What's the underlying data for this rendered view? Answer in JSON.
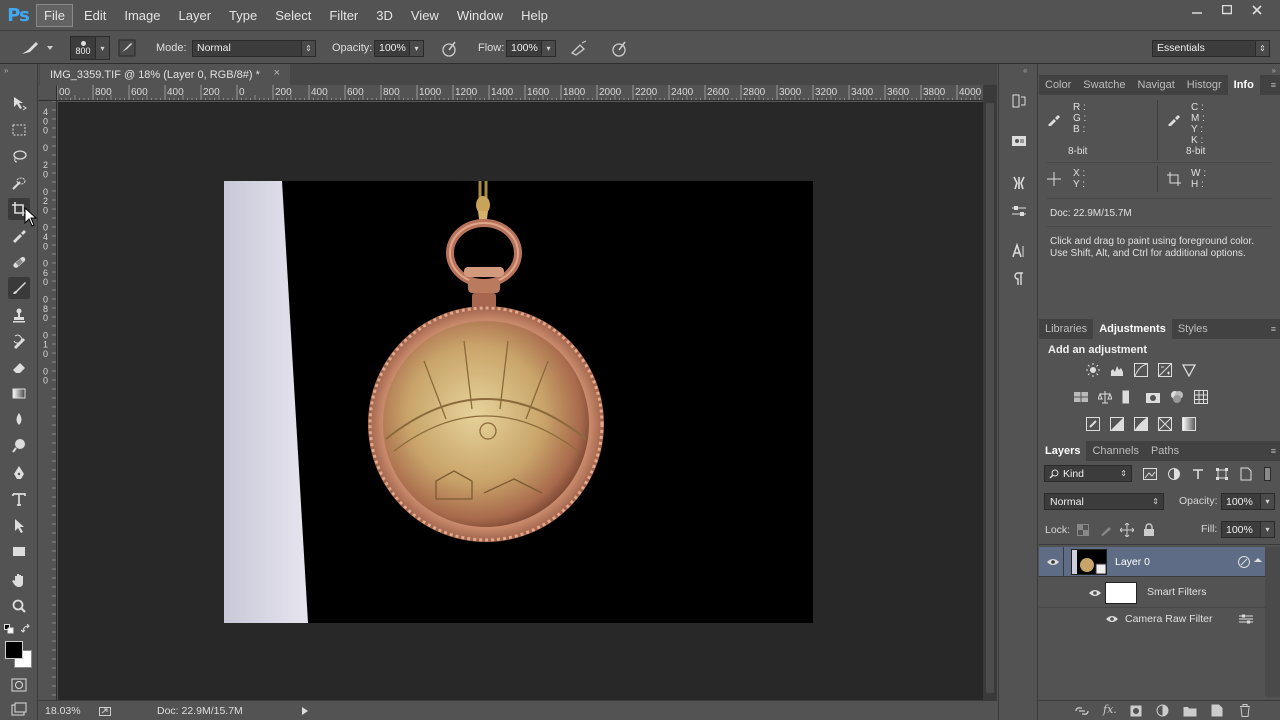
{
  "app": {
    "logo": "Ps"
  },
  "menu": [
    "File",
    "Edit",
    "Image",
    "Layer",
    "Type",
    "Select",
    "Filter",
    "3D",
    "View",
    "Window",
    "Help"
  ],
  "options_bar": {
    "brush_size": "800",
    "mode_label": "Mode:",
    "mode_value": "Normal",
    "opacity_label": "Opacity:",
    "opacity_value": "100%",
    "flow_label": "Flow:",
    "flow_value": "100%",
    "workspace": "Essentials"
  },
  "document": {
    "tab_title": "IMG_3359.TIF @ 18% (Layer 0, RGB/8#) *",
    "close_glyph": "×"
  },
  "rulers": {
    "top_ticks": [
      "00",
      "800",
      "600",
      "400",
      "200",
      "0",
      "200",
      "400",
      "600",
      "800",
      "1000",
      "1200",
      "1400",
      "1600",
      "1800",
      "2000",
      "2200",
      "2400",
      "2600",
      "2800",
      "3000",
      "3200",
      "3400",
      "3600",
      "3800",
      "4000"
    ],
    "left_ticks": [
      "4",
      "0",
      "0",
      "0",
      "2",
      "0",
      "0",
      "2",
      "0",
      "0",
      "4",
      "0",
      "0",
      "6",
      "0",
      "0",
      "8",
      "0",
      "0",
      "1",
      "0",
      "0",
      "0"
    ]
  },
  "status_bar": {
    "zoom": "18.03%",
    "doc": "Doc: 22.9M/15.7M"
  },
  "info_panel": {
    "tabs": [
      "Color",
      "Swatche",
      "Navigat",
      "Histogr",
      "Info"
    ],
    "rgb_labels": [
      "R :",
      "G :",
      "B :"
    ],
    "cmyk_labels": [
      "C :",
      "M :",
      "Y :",
      "K :"
    ],
    "bit_left": "8-bit",
    "bit_right": "8-bit",
    "xy_labels": [
      "X :",
      "Y :"
    ],
    "wh_labels": [
      "W :",
      "H :"
    ],
    "doc": "Doc: 22.9M/15.7M",
    "hint": "Click and drag to paint using foreground color. Use Shift, Alt, and Ctrl for additional options."
  },
  "adjustments_panel": {
    "tabs": [
      "Libraries",
      "Adjustments",
      "Styles"
    ],
    "title": "Add an adjustment"
  },
  "layers_panel": {
    "tabs": [
      "Layers",
      "Channels",
      "Paths"
    ],
    "filter_kind": "Kind",
    "blend_mode": "Normal",
    "opacity_label": "Opacity:",
    "opacity_value": "100%",
    "lock_label": "Lock:",
    "fill_label": "Fill:",
    "fill_value": "100%",
    "layers": [
      {
        "name": "Layer 0"
      },
      {
        "name": "Smart Filters"
      },
      {
        "name": "Camera Raw Filter"
      }
    ]
  },
  "colors": {
    "accent": "#3fa9f5",
    "selected_layer": "#5e6c85",
    "canvas_bg": "#282828"
  }
}
